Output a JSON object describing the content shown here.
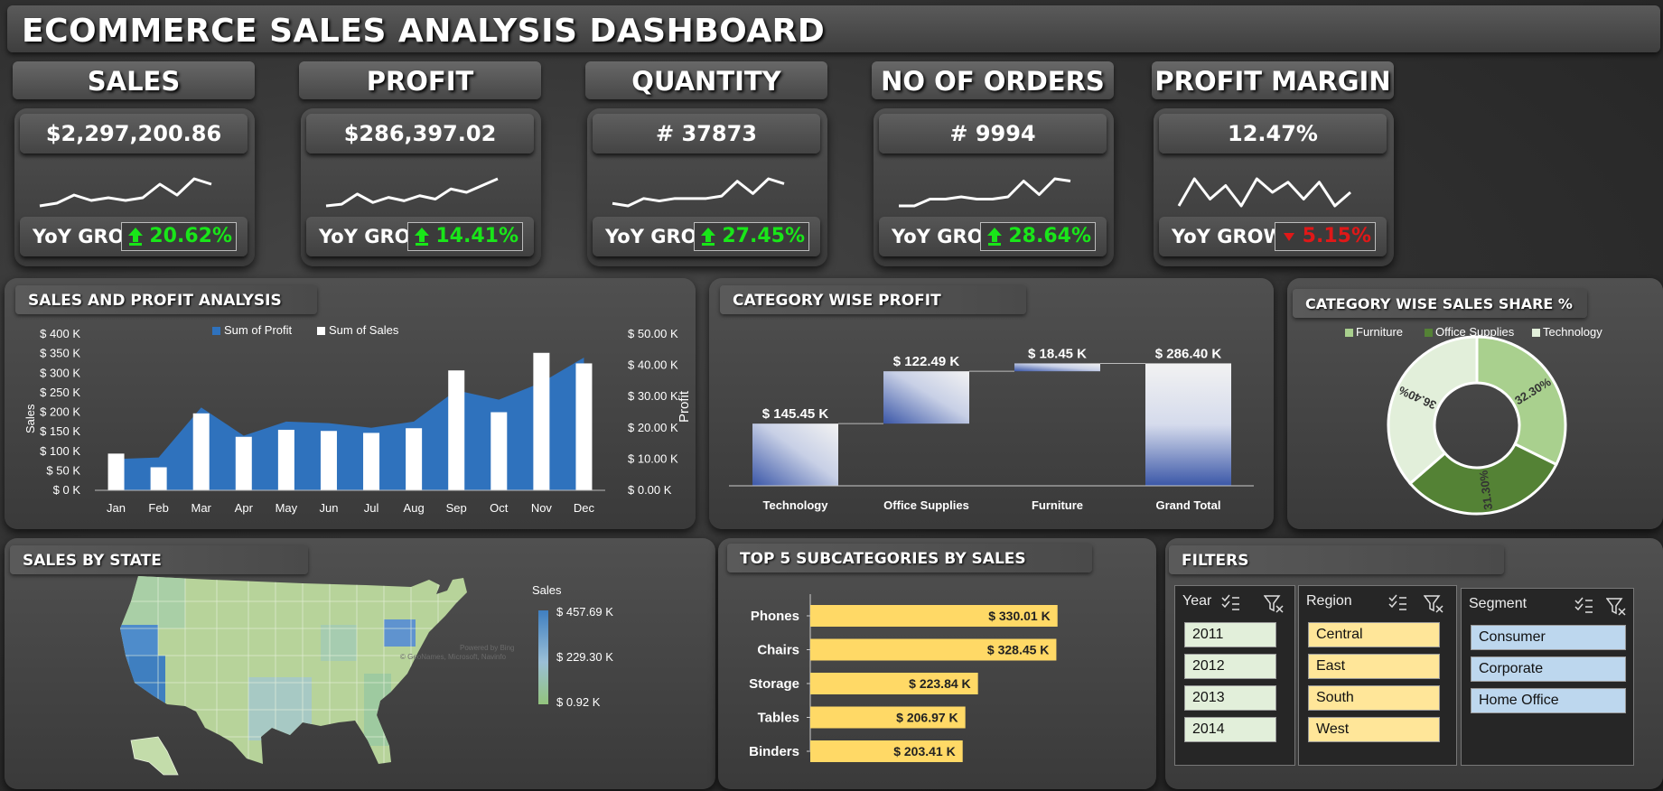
{
  "title": "ECOMMERCE SALES ANALYSIS DASHBOARD",
  "kpis": [
    {
      "label": "SALES",
      "value": "$2,297,200.86",
      "yoy_label": "YoY GROWTH",
      "yoy": "20.62%",
      "direction": "up",
      "spark": [
        3,
        4,
        7,
        5,
        6,
        5,
        6,
        11,
        7,
        13,
        11
      ]
    },
    {
      "label": "PROFIT",
      "value": "$286,397.02",
      "yoy_label": "YoY GROWTH",
      "yoy": "14.41%",
      "direction": "up",
      "spark": [
        2,
        3,
        9,
        4,
        7,
        5,
        8,
        6,
        12,
        10,
        14,
        18
      ]
    },
    {
      "label": "QUANTITY",
      "value": "# 37873",
      "yoy_label": "YoY GROWTH",
      "yoy": "27.45%",
      "direction": "up",
      "spark": [
        4,
        3,
        6,
        5,
        6,
        6,
        6,
        7,
        13,
        8,
        14,
        12
      ]
    },
    {
      "label": "NO OF ORDERS",
      "value": "# 9994",
      "yoy_label": "YoY GROWTH",
      "yoy": "28.64%",
      "direction": "up",
      "spark": [
        3,
        3,
        6,
        6,
        7,
        6,
        6,
        7,
        14,
        8,
        15,
        14
      ]
    },
    {
      "label": "PROFIT MARGIN",
      "value": "12.47%",
      "yoy_label": "YoY GROWTH",
      "yoy": "5.15%",
      "direction": "down",
      "spark": [
        6,
        14,
        8,
        12,
        6,
        14,
        10,
        13,
        8,
        13,
        6,
        10
      ]
    }
  ],
  "colors": {
    "up": "#19e619",
    "down": "#e01818",
    "profit": "#2f72bd",
    "sales": "#ffffff"
  },
  "sales_profit": {
    "title": "SALES AND PROFIT ANALYSIS",
    "legend_profit": "Sum of Profit",
    "legend_sales": "Sum of Sales",
    "y_left_label": "Sales",
    "y_right_label": "Profit",
    "left_ticks": [
      "$ 0 K",
      "$ 50 K",
      "$ 100 K",
      "$ 150 K",
      "$ 200 K",
      "$ 250 K",
      "$ 300 K",
      "$ 350 K",
      "$ 400 K"
    ],
    "right_ticks": [
      "$ 0.00 K",
      "$ 10.00 K",
      "$ 20.00 K",
      "$ 30.00 K",
      "$ 40.00 K",
      "$ 50.00 K"
    ]
  },
  "category_profit": {
    "title": "CATEGORY WISE PROFIT",
    "bars": [
      {
        "label": "Technology",
        "value_label": "$ 145.45 K"
      },
      {
        "label": "Office Supplies",
        "value_label": "$ 122.49 K"
      },
      {
        "label": "Furniture",
        "value_label": "$ 18.45 K"
      },
      {
        "label": "Grand Total",
        "value_label": "$ 286.40 K"
      }
    ]
  },
  "category_share": {
    "title": "CATEGORY WISE SALES SHARE %",
    "legend": [
      "Furniture",
      "Office Supplies",
      "Technology"
    ],
    "slice_labels": [
      "32.30%",
      "31.30%",
      "36.40%"
    ]
  },
  "map": {
    "title": "SALES BY STATE",
    "legend_title": "Sales",
    "legend_max": "$ 457.69 K",
    "legend_mid": "$ 229.30 K",
    "legend_min": "$ 0.92 K",
    "credit1": "Powered by Bing",
    "credit2": "© GeoNames, Microsoft, Navinfo"
  },
  "top5": {
    "title": "TOP 5 SUBCATEGORIES BY SALES",
    "items": [
      {
        "label": "Phones",
        "value_label": "$ 330.01 K"
      },
      {
        "label": "Chairs",
        "value_label": "$ 328.45 K"
      },
      {
        "label": "Storage",
        "value_label": "$ 223.84 K"
      },
      {
        "label": "Tables",
        "value_label": "$ 206.97 K"
      },
      {
        "label": "Binders",
        "value_label": "$ 203.41 K"
      }
    ]
  },
  "filters": {
    "title": "FILTERS",
    "year": {
      "title": "Year",
      "items": [
        "2011",
        "2012",
        "2013",
        "2014"
      ]
    },
    "region": {
      "title": "Region",
      "items": [
        "Central",
        "East",
        "South",
        "West"
      ]
    },
    "segment": {
      "title": "Segment",
      "items": [
        "Consumer",
        "Corporate",
        "Home Office"
      ]
    }
  },
  "chart_data": [
    {
      "type": "bar",
      "title": "SALES AND PROFIT ANALYSIS",
      "categories": [
        "Jan",
        "Feb",
        "Mar",
        "Apr",
        "May",
        "Jun",
        "Jul",
        "Aug",
        "Sep",
        "Oct",
        "Nov",
        "Dec"
      ],
      "series": [
        {
          "name": "Sum of Sales",
          "axis": "left",
          "chart": "bar",
          "values": [
            94,
            59,
            197,
            137,
            155,
            152,
            147,
            159,
            307,
            200,
            352,
            325
          ]
        },
        {
          "name": "Sum of Profit",
          "axis": "right",
          "chart": "area",
          "values": [
            10.0,
            10.5,
            26.5,
            17.5,
            22.0,
            21.5,
            20.0,
            22.0,
            32.0,
            29.0,
            34.5,
            42.5
          ]
        }
      ],
      "ylabel": "Sales",
      "y2label": "Profit",
      "ylim": [
        0,
        400
      ],
      "y2lim": [
        0,
        50
      ]
    },
    {
      "type": "bar",
      "title": "CATEGORY WISE PROFIT",
      "categories": [
        "Technology",
        "Office Supplies",
        "Furniture",
        "Grand Total"
      ],
      "values": [
        145.45,
        122.49,
        18.45,
        286.4
      ],
      "units": "$ K"
    },
    {
      "type": "pie",
      "title": "CATEGORY WISE SALES SHARE %",
      "categories": [
        "Furniture",
        "Office Supplies",
        "Technology"
      ],
      "values": [
        32.3,
        31.3,
        36.4
      ]
    },
    {
      "type": "bar",
      "title": "TOP 5 SUBCATEGORIES BY SALES",
      "categories": [
        "Phones",
        "Chairs",
        "Storage",
        "Tables",
        "Binders"
      ],
      "values": [
        330.01,
        328.45,
        223.84,
        206.97,
        203.41
      ],
      "units": "$ K"
    }
  ]
}
